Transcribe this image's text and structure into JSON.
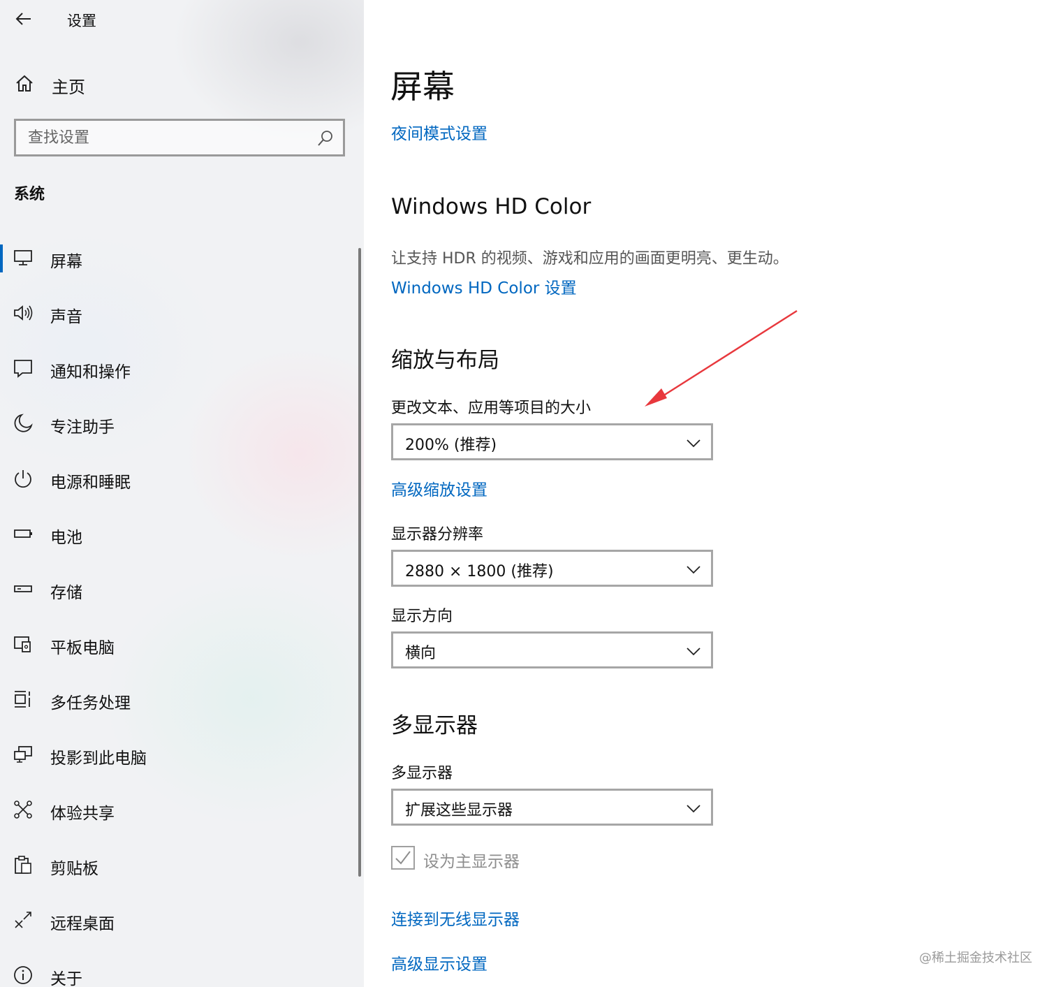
{
  "app": {
    "title": "设置",
    "home_label": "主页",
    "search_placeholder": "查找设置",
    "section_label": "系统"
  },
  "sidebar": {
    "items": [
      {
        "label": "屏幕",
        "icon": "monitor-icon",
        "active": true
      },
      {
        "label": "声音",
        "icon": "speaker-icon"
      },
      {
        "label": "通知和操作",
        "icon": "notification-icon"
      },
      {
        "label": "专注助手",
        "icon": "moon-icon"
      },
      {
        "label": "电源和睡眠",
        "icon": "power-icon"
      },
      {
        "label": "电池",
        "icon": "battery-icon"
      },
      {
        "label": "存储",
        "icon": "storage-icon"
      },
      {
        "label": "平板电脑",
        "icon": "tablet-icon"
      },
      {
        "label": "多任务处理",
        "icon": "multitasking-icon"
      },
      {
        "label": "投影到此电脑",
        "icon": "projection-icon"
      },
      {
        "label": "体验共享",
        "icon": "shared-experience-icon"
      },
      {
        "label": "剪贴板",
        "icon": "clipboard-icon"
      },
      {
        "label": "远程桌面",
        "icon": "remote-desktop-icon"
      },
      {
        "label": "关于",
        "icon": "info-icon"
      }
    ]
  },
  "main": {
    "title": "屏幕",
    "night_light_link": "夜间模式设置",
    "hdr": {
      "heading": "Windows HD Color",
      "description": "让支持 HDR 的视频、游戏和应用的画面更明亮、更生动。",
      "link": "Windows HD Color 设置"
    },
    "scale": {
      "heading": "缩放与布局",
      "size_label": "更改文本、应用等项目的大小",
      "size_value": "200% (推荐)",
      "advanced_link": "高级缩放设置",
      "resolution_label": "显示器分辨率",
      "resolution_value": "2880 × 1800 (推荐)",
      "orientation_label": "显示方向",
      "orientation_value": "横向"
    },
    "multi": {
      "heading": "多显示器",
      "label": "多显示器",
      "value": "扩展这些显示器",
      "main_display_checkbox": "设为主显示器",
      "main_display_checked": true,
      "wireless_link": "连接到无线显示器",
      "advanced_link": "高级显示设置"
    }
  },
  "annotation_arrow_color": "#e8383d",
  "accent_color": "#0067c0",
  "watermark": "@稀土掘金技术社区"
}
